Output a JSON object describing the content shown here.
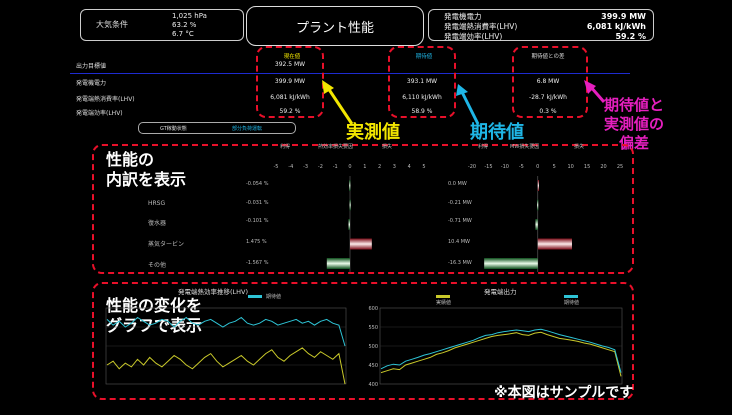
{
  "header": {
    "conditions_label": "大気条件",
    "conditions_values": [
      "1,025 hPa",
      "63.2 %",
      "6.7 °C"
    ],
    "title": "プラント性能",
    "outputs": [
      {
        "label": "発電機電力",
        "value": "399.9 MW"
      },
      {
        "label": "発電端熱消費率(LHV)",
        "value": "6,081 kJ/kWh"
      },
      {
        "label": "発電端効率(LHV)",
        "value": "59.2 %"
      }
    ]
  },
  "summary": {
    "col_headers": [
      "現在値",
      "期待値",
      "期待値との差"
    ],
    "rows": [
      {
        "label": "出力目標値",
        "current": "392.5 MW",
        "expected": "",
        "diff": ""
      },
      {
        "label": "発電機電力",
        "current": "399.9 MW",
        "expected": "393.1 MW",
        "diff": "6.8 MW"
      },
      {
        "label": "発電端熱消費率(LHV)",
        "current": "6,081 kJ/kWh",
        "expected": "6,110 kJ/kWh",
        "diff": "-28.7 kJ/kWh"
      },
      {
        "label": "発電端効率(LHV)",
        "current": "59.2 %",
        "expected": "58.9 %",
        "diff": "0.3 %"
      }
    ],
    "gt_status_label": "GT稼動状態",
    "gt_status_value": "部分負荷運転"
  },
  "annotations": {
    "actual": "実測値",
    "expected": "期待値",
    "deviation": [
      "期待値と",
      "実測値の",
      "偏差"
    ],
    "breakdown": [
      "性能の",
      "内訳を表示"
    ],
    "trend": [
      "性能の変化を",
      "グラフで表示"
    ],
    "sample": "※本図はサンプルです"
  },
  "breakdown": {
    "left_header": [
      "利得",
      "熱効率損失要因",
      "損失"
    ],
    "right_header": [
      "利得",
      "MW損失要因",
      "損失"
    ],
    "categories": [
      "",
      "HRSG",
      "復水器",
      "蒸気タービン",
      "その他"
    ],
    "left_values_text": [
      "-0.054 %",
      "-0.031 %",
      "-0.101 %",
      "1.475 %",
      "-1.567 %"
    ],
    "right_values_text": [
      "0.0 MW",
      "-0.21 MW",
      "-0.71 MW",
      "10.4 MW",
      "-16.3 MW"
    ]
  },
  "chart_data": [
    {
      "type": "bar",
      "title": "熱効率損失要因",
      "categories": [
        "",
        "HRSG",
        "復水器",
        "蒸気タービン",
        "その他"
      ],
      "values": [
        -0.054,
        -0.031,
        -0.101,
        1.475,
        -1.567
      ],
      "xlim": [
        -5,
        5
      ],
      "ticks": [
        -5,
        -4,
        -3,
        -2,
        -1,
        0,
        1,
        2,
        3,
        4,
        5
      ]
    },
    {
      "type": "bar",
      "title": "MW損失要因",
      "categories": [
        "",
        "HRSG",
        "復水器",
        "蒸気タービン",
        "その他"
      ],
      "values": [
        0.0,
        -0.21,
        -0.71,
        10.4,
        -16.3
      ],
      "xlim": [
        -20,
        25
      ],
      "ticks": [
        -20,
        -15,
        -10,
        -5,
        0,
        5,
        10,
        15,
        20,
        25
      ]
    },
    {
      "type": "line",
      "title": "発電端熱効率推移(LHV)",
      "legend": [
        "期待値"
      ],
      "series": [
        {
          "name": "",
          "color": "#2ec4d6",
          "values": [
            64,
            61,
            63,
            60,
            62,
            65,
            63,
            61,
            62,
            64,
            63,
            60,
            63,
            65,
            62,
            61,
            63,
            64,
            62,
            60,
            62,
            63,
            65,
            62,
            61,
            62,
            64,
            63,
            61,
            62,
            63,
            64,
            62,
            63,
            61,
            63,
            64,
            62,
            61,
            50
          ]
        },
        {
          "name": "",
          "color": "#c9c92a",
          "values": [
            40,
            42,
            38,
            41,
            39,
            43,
            40,
            44,
            41,
            39,
            42,
            45,
            43,
            40,
            38,
            41,
            44,
            46,
            42,
            39,
            41,
            43,
            45,
            42,
            40,
            43,
            46,
            48,
            44,
            42,
            45,
            47,
            49,
            46,
            44,
            47,
            45,
            43,
            46,
            30
          ]
        }
      ],
      "ylim": [
        30,
        70
      ]
    },
    {
      "type": "line",
      "title": "発電端出力",
      "legend": [
        "実績値",
        "期待値"
      ],
      "series": [
        {
          "name": "実績値",
          "color": "#c9c92a",
          "values": [
            430,
            435,
            440,
            438,
            450,
            455,
            460,
            465,
            470,
            478,
            482,
            488,
            495,
            500,
            505,
            510,
            515,
            520,
            525,
            528,
            530,
            532,
            535,
            530,
            528,
            534,
            536,
            530,
            525,
            520,
            518,
            515,
            512,
            508,
            505,
            500,
            495,
            490,
            485,
            420
          ]
        },
        {
          "name": "期待値",
          "color": "#2ec4d6",
          "values": [
            440,
            448,
            452,
            450,
            460,
            465,
            470,
            476,
            480,
            485,
            490,
            495,
            500,
            505,
            510,
            515,
            522,
            528,
            530,
            535,
            538,
            540,
            542,
            540,
            538,
            542,
            544,
            540,
            535,
            530,
            526,
            522,
            518,
            514,
            510,
            505,
            500,
            496,
            490,
            430
          ]
        }
      ],
      "ylim": [
        400,
        600
      ],
      "yticks": [
        400,
        450,
        500,
        550,
        600
      ]
    }
  ],
  "colors": {
    "red_dash": "#e8102a",
    "annot_yellow": "#f2e600",
    "annot_cyan": "#1fb6e6",
    "annot_magenta": "#e61fbf"
  }
}
